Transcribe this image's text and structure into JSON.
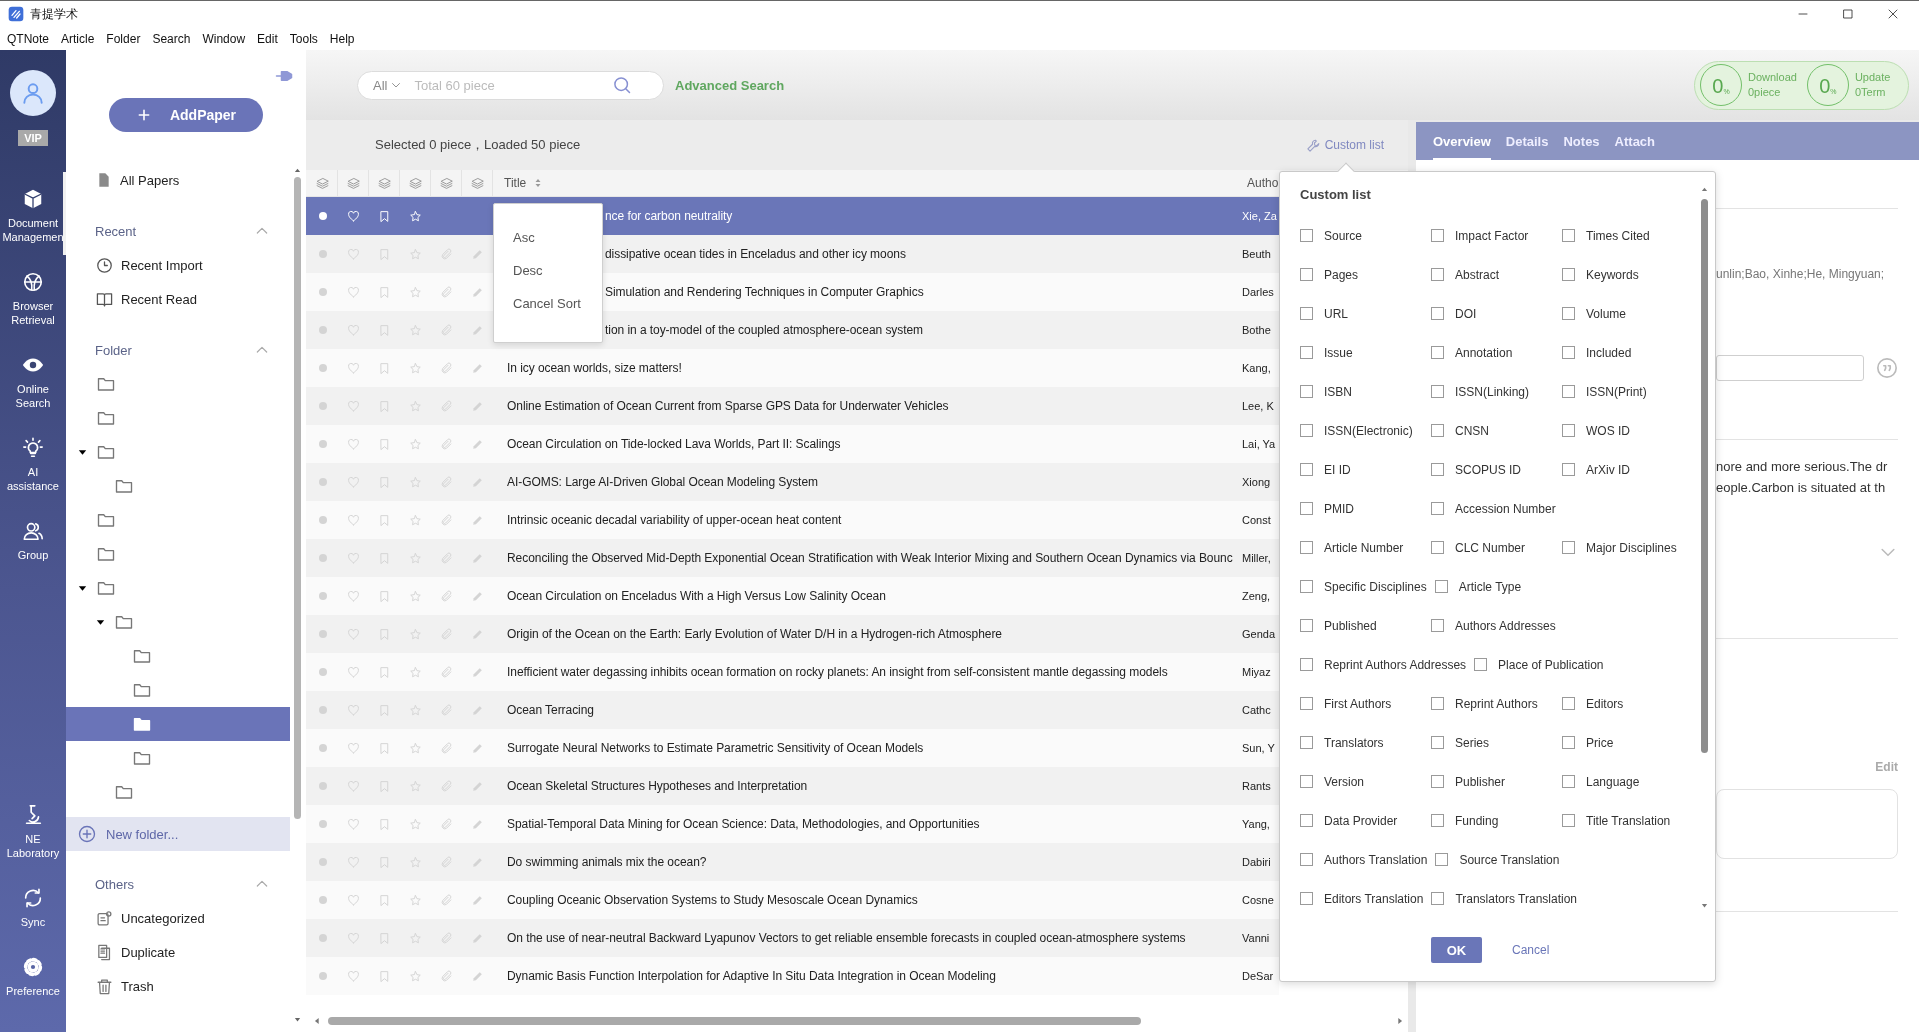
{
  "window": {
    "title": "青提学术"
  },
  "menu": [
    "QTNote",
    "Article",
    "Folder",
    "Search",
    "Window",
    "Edit",
    "Tools",
    "Help"
  ],
  "nav": {
    "vip": "VIP",
    "items": [
      {
        "label": "Document Managemen",
        "selected": true
      },
      {
        "label": "Browser Retrieval",
        "selected": false
      },
      {
        "label": "Online Search",
        "selected": false
      },
      {
        "label": "AI assistance",
        "selected": false
      },
      {
        "label": "Group",
        "selected": false
      }
    ],
    "bottom_items": [
      "NE Laboratory",
      "Sync",
      "Preference"
    ]
  },
  "sidebar": {
    "add_button": "AddPaper",
    "all_papers": "All Papers",
    "recent": {
      "title": "Recent",
      "expanded": true,
      "items": [
        "Recent Import",
        "Recent Read"
      ]
    },
    "folder": {
      "title": "Folder",
      "expanded": true,
      "new_folder": "New folder...",
      "tree": [
        {
          "selected": false
        },
        {
          "selected": false
        },
        {
          "selected": false,
          "expanded": true,
          "children": [
            {
              "selected": false
            }
          ]
        },
        {
          "selected": false
        },
        {
          "selected": false
        },
        {
          "selected": false,
          "expanded": true,
          "children": [
            {
              "selected": false,
              "expanded": true,
              "children": [
                {
                  "selected": false
                },
                {
                  "selected": false
                },
                {
                  "selected": true
                },
                {
                  "selected": false
                }
              ]
            },
            {
              "selected": false
            }
          ]
        }
      ]
    },
    "others": {
      "title": "Others",
      "expanded": true,
      "items": [
        "Uncategorized",
        "Duplicate",
        "Trash"
      ]
    }
  },
  "search": {
    "scope": "All",
    "placeholder": "Total 60 piece",
    "advanced": "Advanced Search"
  },
  "progress": [
    {
      "value": "0",
      "unit": "%",
      "label": "Download",
      "count": "0piece"
    },
    {
      "value": "0",
      "unit": "%",
      "label": "Update",
      "count": "0Term"
    }
  ],
  "table": {
    "status": "Selected 0 piece，Loaded 50 piece",
    "custom_list_link": "Custom list",
    "columns": [
      "Title",
      "Autho"
    ],
    "rows": [
      {
        "title": "nce for carbon neutrality",
        "author": "Xie, Za",
        "selected": true,
        "partly_hidden": true
      },
      {
        "title": "dissipative ocean tides in Enceladus and other icy moons",
        "author": "Beuth",
        "selected": false,
        "partly_hidden": true
      },
      {
        "title": "Simulation and Rendering Techniques in Computer Graphics",
        "author": "Darles",
        "selected": false,
        "partly_hidden": true
      },
      {
        "title": "tion in a toy-model of the coupled atmosphere-ocean system",
        "author": "Bothe",
        "selected": false,
        "partly_hidden": true
      },
      {
        "title": "In icy ocean worlds, size matters!",
        "author": "Kang,",
        "selected": false,
        "partly_hidden": false
      },
      {
        "title": "Online Estimation of Ocean Current from Sparse GPS Data for Underwater Vehicles",
        "author": "Lee, K",
        "selected": false,
        "partly_hidden": false
      },
      {
        "title": "Ocean Circulation on Tide-locked Lava Worlds, Part II: Scalings",
        "author": "Lai, Ya",
        "selected": false,
        "partly_hidden": false
      },
      {
        "title": "AI-GOMS: Large AI-Driven Global Ocean Modeling System",
        "author": "Xiong",
        "selected": false,
        "partly_hidden": false
      },
      {
        "title": "Intrinsic oceanic decadal variability of upper-ocean heat content",
        "author": "Const",
        "selected": false,
        "partly_hidden": false
      },
      {
        "title": "Reconciling the Observed Mid-Depth Exponential Ocean Stratification with Weak Interior Mixing and Southern Ocean Dynamics via Bounc",
        "author": "Miller,",
        "selected": false,
        "partly_hidden": false
      },
      {
        "title": "Ocean Circulation on Enceladus With a High Versus Low Salinity Ocean",
        "author": "Zeng,",
        "selected": false,
        "partly_hidden": false
      },
      {
        "title": "Origin of the Ocean on the Earth: Early Evolution of Water D/H in a Hydrogen-rich Atmosphere",
        "author": "Genda",
        "selected": false,
        "partly_hidden": false
      },
      {
        "title": "Inefficient water degassing inhibits ocean formation on rocky planets: An insight from self-consistent mantle degassing models",
        "author": "Miyaz",
        "selected": false,
        "partly_hidden": false
      },
      {
        "title": "Ocean Terracing",
        "author": "Cathc",
        "selected": false,
        "partly_hidden": false
      },
      {
        "title": "Surrogate Neural Networks to Estimate Parametric Sensitivity of Ocean Models",
        "author": "Sun, Y",
        "selected": false,
        "partly_hidden": false
      },
      {
        "title": "Ocean Skeletal Structures Hypotheses and Interpretation",
        "author": "Rants",
        "selected": false,
        "partly_hidden": false
      },
      {
        "title": "Spatial-Temporal Data Mining for Ocean Science: Data, Methodologies, and Opportunities",
        "author": "Yang,",
        "selected": false,
        "partly_hidden": false
      },
      {
        "title": "Do swimming animals mix the ocean?",
        "author": "Dabiri",
        "selected": false,
        "partly_hidden": false
      },
      {
        "title": "Coupling Oceanic Observation Systems to Study Mesoscale Ocean Dynamics",
        "author": "Cosne",
        "selected": false,
        "partly_hidden": false
      },
      {
        "title": "On the use of near-neutral Backward Lyapunov Vectors to get reliable ensemble forecasts in coupled ocean-atmosphere systems",
        "author": "Vanni",
        "selected": false,
        "partly_hidden": false
      },
      {
        "title": "Dynamic Basis Function Interpolation for Adaptive In Situ Data Integration in Ocean Modeling",
        "author": "DeSar",
        "selected": false,
        "partly_hidden": false
      }
    ]
  },
  "sort_menu": [
    "Asc",
    "Desc",
    "Cancel Sort"
  ],
  "detail": {
    "tabs": [
      {
        "label": "Overview",
        "selected": true
      },
      {
        "label": "Details",
        "selected": false
      },
      {
        "label": "Notes",
        "selected": false
      },
      {
        "label": "Attach",
        "selected": false
      }
    ],
    "authors": "unlin;Bao, Xinhe;He, Mingyuan;",
    "abstract": [
      "nore and more serious.The dr",
      "eople.Carbon is situated at th"
    ],
    "edit": "Edit"
  },
  "custom_list": {
    "title": "Custom list",
    "ok": "OK",
    "cancel": "Cancel",
    "rows": [
      [
        {
          "label": "Source",
          "checked": false
        },
        {
          "label": "Impact Factor",
          "checked": false
        },
        {
          "label": "Times Cited",
          "checked": false
        }
      ],
      [
        {
          "label": "Pages",
          "checked": false
        },
        {
          "label": "Abstract",
          "checked": false
        },
        {
          "label": "Keywords",
          "checked": false
        }
      ],
      [
        {
          "label": "URL",
          "checked": false
        },
        {
          "label": "DOI",
          "checked": false
        },
        {
          "label": "Volume",
          "checked": false
        }
      ],
      [
        {
          "label": "Issue",
          "checked": false
        },
        {
          "label": "Annotation",
          "checked": false
        },
        {
          "label": "Included",
          "checked": false
        }
      ],
      [
        {
          "label": "ISBN",
          "checked": false
        },
        {
          "label": "ISSN(Linking)",
          "checked": false
        },
        {
          "label": "ISSN(Print)",
          "checked": false
        }
      ],
      [
        {
          "label": "ISSN(Electronic)",
          "checked": false
        },
        {
          "label": "CNSN",
          "checked": false
        },
        {
          "label": "WOS ID",
          "checked": false
        }
      ],
      [
        {
          "label": "EI ID",
          "checked": false
        },
        {
          "label": "SCOPUS ID",
          "checked": false
        },
        {
          "label": "ArXiv ID",
          "checked": false
        }
      ],
      [
        {
          "label": "PMID",
          "checked": false
        },
        {
          "label": "Accession Number",
          "checked": false
        }
      ],
      [
        {
          "label": "Article Number",
          "checked": false
        },
        {
          "label": "CLC Number",
          "checked": false
        },
        {
          "label": "Major Disciplines",
          "checked": false
        }
      ],
      [
        {
          "label": "Specific Disciplines",
          "checked": false
        },
        {
          "label": "Article Type",
          "checked": false
        }
      ],
      [
        {
          "label": "Published",
          "checked": false
        },
        {
          "label": "Authors Addresses",
          "checked": false
        }
      ],
      [
        {
          "label": "Reprint Authors Addresses",
          "checked": false
        },
        {
          "label": "Place of Publication",
          "checked": false
        }
      ],
      [
        {
          "label": "First Authors",
          "checked": false
        },
        {
          "label": "Reprint Authors",
          "checked": false
        },
        {
          "label": "Editors",
          "checked": false
        }
      ],
      [
        {
          "label": "Translators",
          "checked": false
        },
        {
          "label": "Series",
          "checked": false
        },
        {
          "label": "Price",
          "checked": false
        }
      ],
      [
        {
          "label": "Version",
          "checked": false
        },
        {
          "label": "Publisher",
          "checked": false
        },
        {
          "label": "Language",
          "checked": false
        }
      ],
      [
        {
          "label": "Data Provider",
          "checked": false
        },
        {
          "label": "Funding",
          "checked": false
        },
        {
          "label": "Title Translation",
          "checked": false
        }
      ],
      [
        {
          "label": "Authors Translation",
          "checked": false
        },
        {
          "label": "Source Translation",
          "checked": false
        }
      ],
      [
        {
          "label": "Editors Translation",
          "checked": false
        },
        {
          "label": "Translators Translation",
          "checked": false
        }
      ]
    ]
  }
}
